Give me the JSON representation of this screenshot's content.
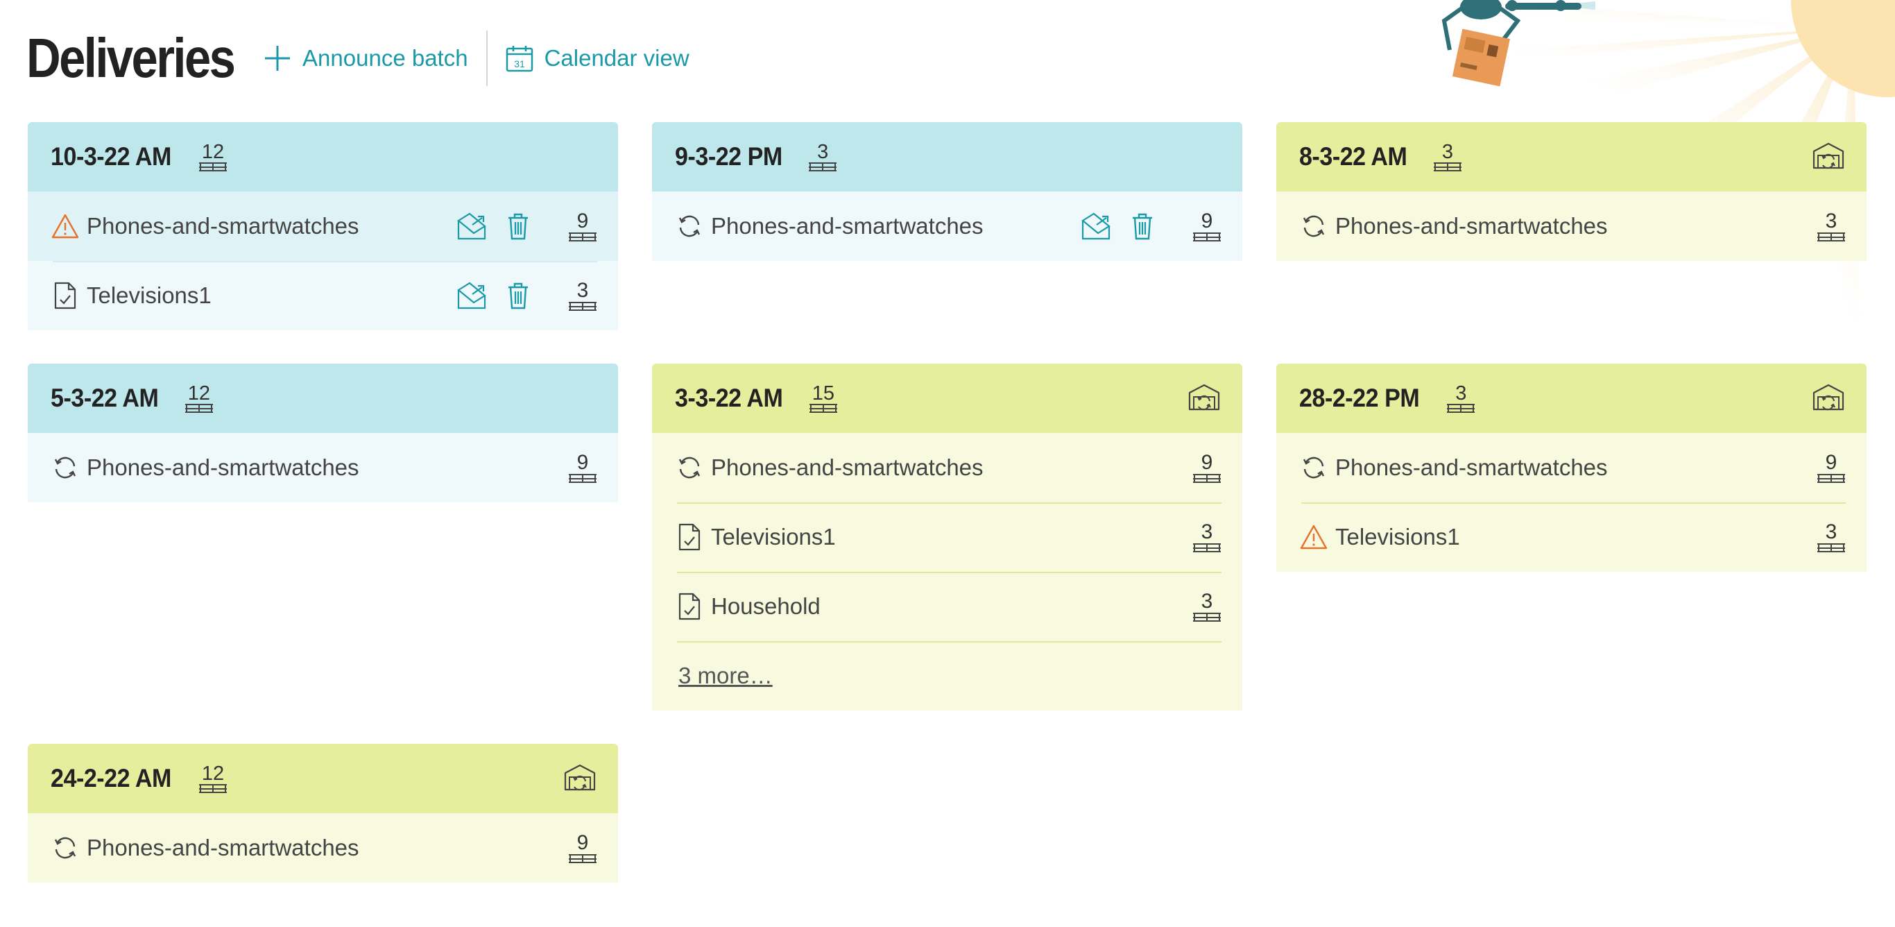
{
  "page_title": "Deliveries",
  "actions": {
    "announce": "Announce batch",
    "calendar": "Calendar view",
    "calendar_day": "31"
  },
  "colors": {
    "accent": "#1a9aa6",
    "warning": "#e8702a",
    "blue_header": "#bde7ea",
    "green_header": "#e5ee9c"
  },
  "cards": [
    {
      "date": "10-3-22 AM",
      "count": "12",
      "theme": "blue",
      "header_icon": false,
      "rows": [
        {
          "status": "warning-icon",
          "label": "Phones-and-smartwatches",
          "count": "9",
          "actions": true
        },
        {
          "status": "file-check-icon",
          "label": "Televisions1",
          "count": "3",
          "actions": true
        }
      ]
    },
    {
      "date": "9-3-22 PM",
      "count": "3",
      "theme": "blue",
      "header_icon": false,
      "rows": [
        {
          "status": "refresh-icon",
          "label": "Phones-and-smartwatches",
          "count": "9",
          "actions": true
        }
      ]
    },
    {
      "date": "8-3-22 AM",
      "count": "3",
      "theme": "green",
      "header_icon": true,
      "rows": [
        {
          "status": "refresh-icon",
          "label": "Phones-and-smartwatches",
          "count": "3",
          "actions": false
        }
      ]
    },
    {
      "date": "5-3-22 AM",
      "count": "12",
      "theme": "blue",
      "header_icon": false,
      "rows": [
        {
          "status": "refresh-icon",
          "label": "Phones-and-smartwatches",
          "count": "9",
          "actions": false
        }
      ]
    },
    {
      "date": "3-3-22 AM",
      "count": "15",
      "theme": "green",
      "header_icon": true,
      "rows": [
        {
          "status": "refresh-icon",
          "label": "Phones-and-smartwatches",
          "count": "9",
          "actions": false
        },
        {
          "status": "file-check-icon",
          "label": "Televisions1",
          "count": "3",
          "actions": false
        },
        {
          "status": "file-check-icon",
          "label": "Household",
          "count": "3",
          "actions": false
        }
      ],
      "more": "3 more…"
    },
    {
      "date": "28-2-22 PM",
      "count": "3",
      "theme": "green",
      "header_icon": true,
      "rows": [
        {
          "status": "refresh-icon",
          "label": "Phones-and-smartwatches",
          "count": "9",
          "actions": false
        },
        {
          "status": "warning-icon",
          "label": "Televisions1",
          "count": "3",
          "actions": false
        }
      ]
    },
    {
      "date": "24-2-22 AM",
      "count": "12",
      "theme": "green",
      "header_icon": true,
      "rows": [
        {
          "status": "refresh-icon",
          "label": "Phones-and-smartwatches",
          "count": "9",
          "actions": false
        }
      ]
    }
  ]
}
